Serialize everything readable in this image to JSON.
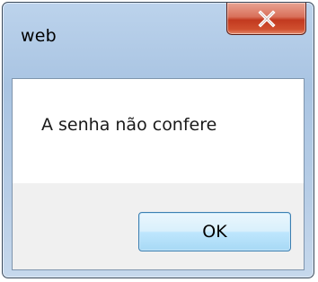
{
  "dialog": {
    "title": "web",
    "message": "A senha não confere",
    "close_icon": "close-icon",
    "buttons": {
      "ok_label": "OK"
    }
  },
  "colors": {
    "close_button": "#c7432a",
    "ok_border": "#3c7fb1",
    "button_area_bg": "#f0f0f0",
    "frame": "#b7cde6"
  }
}
